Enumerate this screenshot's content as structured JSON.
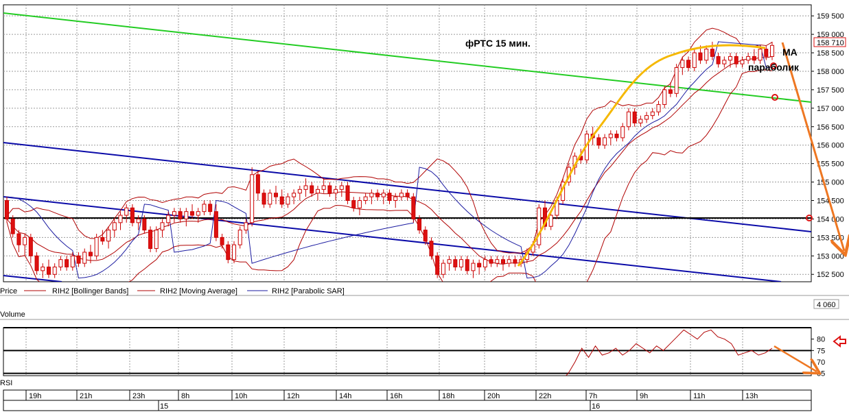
{
  "chart_data": [
    {
      "type": "candlestick",
      "title": "фРТС   15 мин.",
      "panel": "Price",
      "yticks": [
        "159 500",
        "159 000",
        "158 500",
        "158 000",
        "157 500",
        "157 000",
        "156 500",
        "156 000",
        "155 500",
        "155 000",
        "154 500",
        "154 000",
        "153 500",
        "153 000",
        "152 500"
      ],
      "ylim": [
        152300,
        159800
      ],
      "last_price": "158 710",
      "last_price_value": 158710,
      "legend": [
        {
          "label": "Price",
          "color": "#000000"
        },
        {
          "label": "RIH2 [Bollinger Bands]",
          "color": "#b00000"
        },
        {
          "label": "RIH2 [Moving Average]",
          "color": "#b00000"
        },
        {
          "label": "RIH2 [Parabolic SAR]",
          "color": "#1a1aa0"
        }
      ],
      "annotations": [
        "МА",
        "параболик"
      ],
      "horizontal_level": 154000,
      "colors": {
        "up": "#ffffff",
        "down": "#dd1111",
        "wick": "#cc0000",
        "trend_green": "#22cc22",
        "trend_blue": "#0a0aa8",
        "arc": "#f5b800",
        "arrow": "#ee7722"
      },
      "candles": [
        [
          154500,
          154600,
          153900,
          154000
        ],
        [
          154000,
          154100,
          153500,
          153600
        ],
        [
          153600,
          153700,
          153100,
          153300
        ],
        [
          153300,
          153600,
          153000,
          153500
        ],
        [
          153500,
          153600,
          152800,
          153000
        ],
        [
          153000,
          153100,
          152500,
          152600
        ],
        [
          152600,
          152800,
          152400,
          152700
        ],
        [
          152700,
          152900,
          152400,
          152500
        ],
        [
          152500,
          152800,
          152400,
          152700
        ],
        [
          152700,
          153000,
          152600,
          152900
        ],
        [
          152900,
          153000,
          152600,
          152700
        ],
        [
          152700,
          153100,
          152600,
          153000
        ],
        [
          153000,
          153100,
          152700,
          152800
        ],
        [
          152800,
          153200,
          152700,
          153100
        ],
        [
          153100,
          153300,
          152800,
          153000
        ],
        [
          153000,
          153600,
          152900,
          153500
        ],
        [
          153500,
          153700,
          153300,
          153400
        ],
        [
          153400,
          153800,
          153200,
          153700
        ],
        [
          153700,
          154000,
          153500,
          153900
        ],
        [
          153900,
          154200,
          153700,
          154100
        ],
        [
          154100,
          154400,
          153900,
          154300
        ],
        [
          154300,
          154400,
          153800,
          153900
        ],
        [
          153900,
          154100,
          153700,
          154000
        ],
        [
          154000,
          154100,
          153600,
          153700
        ],
        [
          153700,
          153800,
          153100,
          153200
        ],
        [
          153200,
          153800,
          153100,
          153700
        ],
        [
          153700,
          154000,
          153500,
          153900
        ],
        [
          153900,
          154200,
          153800,
          154100
        ],
        [
          154100,
          154300,
          153900,
          154200
        ],
        [
          154200,
          154300,
          153900,
          154000
        ],
        [
          154000,
          154300,
          153800,
          154200
        ],
        [
          154200,
          154400,
          154000,
          154100
        ],
        [
          154100,
          154300,
          153900,
          154200
        ],
        [
          154200,
          154500,
          154100,
          154400
        ],
        [
          154400,
          154500,
          154100,
          154200
        ],
        [
          154200,
          154400,
          153400,
          153500
        ],
        [
          153500,
          153600,
          153200,
          153300
        ],
        [
          153300,
          153400,
          152800,
          152900
        ],
        [
          152900,
          153400,
          152800,
          153300
        ],
        [
          153300,
          153800,
          153200,
          153700
        ],
        [
          153700,
          154000,
          153600,
          153900
        ],
        [
          153900,
          155400,
          153800,
          155200
        ],
        [
          155200,
          155300,
          154500,
          154700
        ],
        [
          154700,
          154800,
          154300,
          154400
        ],
        [
          154400,
          154800,
          154300,
          154700
        ],
        [
          154700,
          154900,
          154400,
          154600
        ],
        [
          154600,
          154800,
          154300,
          154400
        ],
        [
          154400,
          154700,
          154300,
          154600
        ],
        [
          154600,
          154800,
          154400,
          154700
        ],
        [
          154700,
          154900,
          154500,
          154800
        ],
        [
          154800,
          155100,
          154600,
          154900
        ],
        [
          154900,
          155000,
          154600,
          154700
        ],
        [
          154700,
          154900,
          154500,
          154800
        ],
        [
          154800,
          155100,
          154700,
          154900
        ],
        [
          154900,
          155000,
          154600,
          154700
        ],
        [
          154700,
          154900,
          154500,
          154800
        ],
        [
          154800,
          155000,
          154600,
          154900
        ],
        [
          154900,
          155000,
          154400,
          154500
        ],
        [
          154500,
          154600,
          154200,
          154300
        ],
        [
          154300,
          154600,
          154100,
          154500
        ],
        [
          154500,
          154700,
          154400,
          154600
        ],
        [
          154600,
          154800,
          154400,
          154700
        ],
        [
          154700,
          154800,
          154500,
          154600
        ],
        [
          154600,
          154800,
          154400,
          154700
        ],
        [
          154700,
          154800,
          154400,
          154500
        ],
        [
          154500,
          154700,
          154300,
          154600
        ],
        [
          154600,
          154800,
          154500,
          154700
        ],
        [
          154700,
          154800,
          154500,
          154600
        ],
        [
          154600,
          154700,
          153900,
          154000
        ],
        [
          154000,
          154100,
          153600,
          153700
        ],
        [
          153700,
          153800,
          153300,
          153400
        ],
        [
          153400,
          153500,
          152900,
          153000
        ],
        [
          153000,
          153100,
          152400,
          152500
        ],
        [
          152500,
          152900,
          152400,
          152800
        ],
        [
          152800,
          153000,
          152600,
          152900
        ],
        [
          152900,
          153000,
          152600,
          152700
        ],
        [
          152700,
          153000,
          152600,
          152900
        ],
        [
          152900,
          153000,
          152500,
          152600
        ],
        [
          152600,
          152900,
          152400,
          152800
        ],
        [
          152800,
          152900,
          152500,
          152700
        ],
        [
          152700,
          153000,
          152600,
          152900
        ],
        [
          152900,
          153000,
          152700,
          152800
        ],
        [
          152800,
          153000,
          152700,
          152900
        ],
        [
          152900,
          153000,
          152600,
          152800
        ],
        [
          152800,
          153000,
          152700,
          152900
        ],
        [
          152900,
          153000,
          152700,
          152800
        ],
        [
          152800,
          153000,
          152700,
          152900
        ],
        [
          152900,
          153200,
          152800,
          153100
        ],
        [
          153100,
          153400,
          153000,
          153300
        ],
        [
          153300,
          154400,
          153200,
          154300
        ],
        [
          154300,
          154500,
          153700,
          153800
        ],
        [
          153800,
          154200,
          153700,
          154100
        ],
        [
          154100,
          154600,
          154000,
          154500
        ],
        [
          154500,
          155100,
          154400,
          155000
        ],
        [
          155000,
          155500,
          154900,
          155400
        ],
        [
          155400,
          155800,
          155200,
          155700
        ],
        [
          155700,
          155900,
          155500,
          155600
        ],
        [
          155600,
          156400,
          155500,
          156300
        ],
        [
          156300,
          156500,
          156000,
          156200
        ],
        [
          156200,
          156300,
          155900,
          156000
        ],
        [
          156000,
          156300,
          155900,
          156200
        ],
        [
          156200,
          156400,
          156000,
          156300
        ],
        [
          156300,
          156400,
          156100,
          156200
        ],
        [
          156200,
          156600,
          156100,
          156500
        ],
        [
          156500,
          157000,
          156400,
          156900
        ],
        [
          156900,
          157000,
          156500,
          156600
        ],
        [
          156600,
          156800,
          156500,
          156700
        ],
        [
          156700,
          156900,
          156600,
          156800
        ],
        [
          156800,
          157000,
          156700,
          156900
        ],
        [
          156900,
          157200,
          156800,
          157100
        ],
        [
          157100,
          157600,
          157000,
          157500
        ],
        [
          157500,
          157700,
          157300,
          157400
        ],
        [
          157400,
          158200,
          157300,
          158100
        ],
        [
          158100,
          158400,
          157900,
          158300
        ],
        [
          158300,
          158400,
          158000,
          158100
        ],
        [
          158100,
          158600,
          158000,
          158500
        ],
        [
          158500,
          158700,
          158200,
          158300
        ],
        [
          158300,
          158700,
          158200,
          158600
        ],
        [
          158600,
          158800,
          158300,
          158400
        ],
        [
          158400,
          158500,
          158100,
          158200
        ],
        [
          158200,
          158400,
          158100,
          158300
        ],
        [
          158300,
          158500,
          158100,
          158400
        ],
        [
          158400,
          158500,
          158100,
          158200
        ],
        [
          158200,
          158400,
          158100,
          158300
        ],
        [
          158300,
          158500,
          158200,
          158400
        ],
        [
          158400,
          158600,
          158200,
          158300
        ],
        [
          158300,
          158700,
          158200,
          158600
        ],
        [
          158600,
          158700,
          158300,
          158400
        ],
        [
          158400,
          158800,
          158300,
          158700
        ]
      ]
    },
    {
      "type": "line",
      "panel": "Volume",
      "last_value": "4 060"
    },
    {
      "type": "line",
      "panel": "RSI",
      "yticks": [
        "80",
        "75",
        "70",
        "65"
      ],
      "ylim": [
        64,
        85
      ],
      "levels": [
        85,
        75,
        65
      ],
      "series": [
        {
          "values": [
            62,
            65,
            70,
            76,
            72,
            77,
            73,
            74,
            76,
            73,
            75,
            78,
            76,
            74,
            77,
            75,
            78,
            81,
            84,
            82,
            80,
            83,
            84,
            81,
            80,
            78,
            73,
            74,
            75,
            73,
            74,
            76
          ]
        }
      ]
    }
  ],
  "time_axis": {
    "hours": [
      "19h",
      "21h",
      "23h",
      "8h",
      "10h",
      "12h",
      "14h",
      "16h",
      "18h",
      "20h",
      "22h",
      "7h",
      "9h",
      "11h",
      "13h"
    ],
    "days": [
      "15",
      "16"
    ]
  }
}
